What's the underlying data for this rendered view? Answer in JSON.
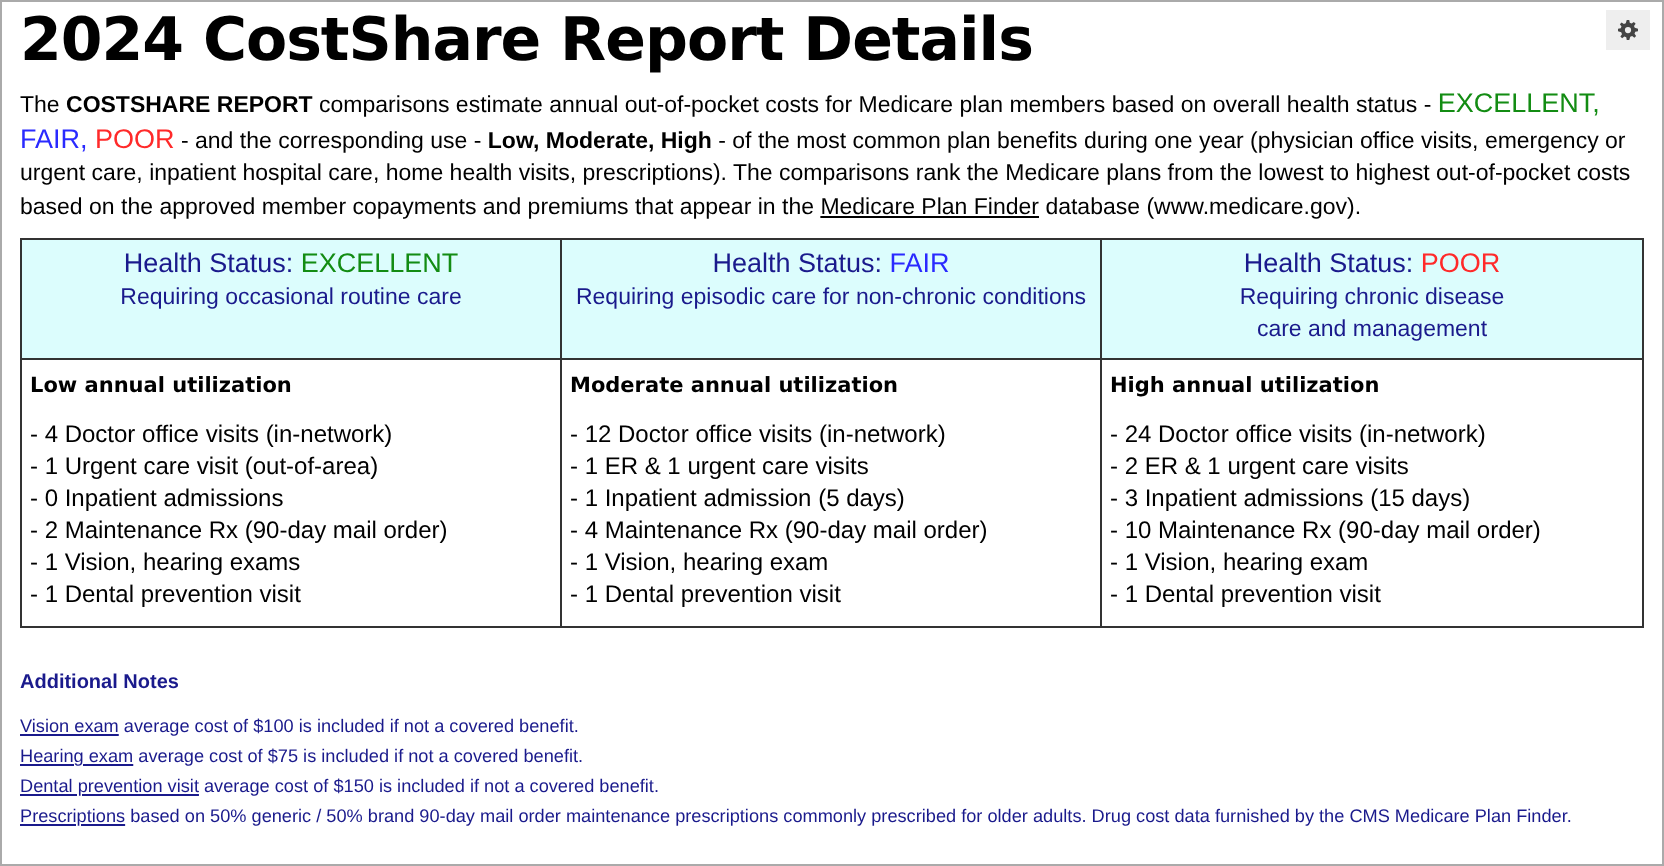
{
  "title": "2024 CostShare Report Details",
  "intro": [
    {
      "kind": "text",
      "text": "The "
    },
    {
      "kind": "bold",
      "text": "COSTSHARE REPORT"
    },
    {
      "kind": "text",
      "text": " comparisons estimate annual out-of-pocket costs for Medicare plan members based on overall health status - "
    },
    {
      "kind": "status",
      "text": "EXCELLENT,",
      "color": "#138c13"
    },
    {
      "kind": "status",
      "text": " FAIR,",
      "color": "#2a2aff"
    },
    {
      "kind": "status",
      "text": " POOR",
      "color": "#ff2a2a"
    },
    {
      "kind": "text",
      "text": " - and the corresponding use - "
    },
    {
      "kind": "bold",
      "text": "Low, Moderate, High"
    },
    {
      "kind": "text",
      "text": " - of the most common plan benefits during one year (physician office visits, emergency or urgent care, inpatient hospital care, home health visits, prescriptions). The comparisons rank the Medicare plans from the lowest to highest out-of-pocket costs based on the approved member copayments and premiums that appear in the "
    },
    {
      "kind": "link",
      "text": "Medicare Plan Finder"
    },
    {
      "kind": "text",
      "text": " database (www.medicare.gov)."
    }
  ],
  "table": {
    "columns": [
      {
        "label": "Health Status:",
        "status": "EXCELLENT",
        "color": "#138c13",
        "subtitle": [
          "Requiring occasional routine care"
        ],
        "utilization": "Low annual utilization",
        "items": [
          "- 4 Doctor office visits (in-network)",
          "- 1 Urgent care visit (out-of-area)",
          "- 0 Inpatient admissions",
          "- 2 Maintenance Rx (90-day mail order)",
          "- 1 Vision, hearing exams",
          "- 1 Dental prevention visit"
        ]
      },
      {
        "label": "Health Status:",
        "status": "FAIR",
        "color": "#2a2aff",
        "subtitle": [
          "Requiring episodic care for non-chronic conditions"
        ],
        "utilization": "Moderate annual utilization",
        "items": [
          "- 12 Doctor office visits (in-network)",
          "- 1 ER & 1 urgent care visits",
          "- 1 Inpatient admission (5 days)",
          "- 4 Maintenance Rx (90-day mail order)",
          "- 1 Vision, hearing exam",
          "- 1 Dental prevention visit"
        ]
      },
      {
        "label": "Health Status:",
        "status": "POOR",
        "color": "#ff2a2a",
        "subtitle": [
          "Requiring chronic disease",
          "care and management"
        ],
        "utilization": "High annual utilization",
        "items": [
          "- 24 Doctor office visits (in-network)",
          "- 2 ER & 1 urgent care visits",
          "- 3 Inpatient admissions (15 days)",
          "- 10 Maintenance Rx (90-day mail order)",
          "- 1 Vision, hearing exam",
          "- 1 Dental prevention visit"
        ]
      }
    ]
  },
  "notes": {
    "heading": "Additional Notes",
    "items": [
      {
        "link": "Vision exam",
        "text": " average cost of $100 is included if not a covered benefit."
      },
      {
        "link": "Hearing exam",
        "text": " average cost of $75 is included if not a covered benefit."
      },
      {
        "link": "Dental prevention visit",
        "text": " average cost of $150 is included if not a covered benefit."
      },
      {
        "link": "Prescriptions",
        "text": " based on 50% generic / 50% brand 90-day mail order maintenance prescriptions commonly prescribed for older adults.  Drug cost data furnished by the CMS Medicare Plan Finder."
      }
    ]
  }
}
